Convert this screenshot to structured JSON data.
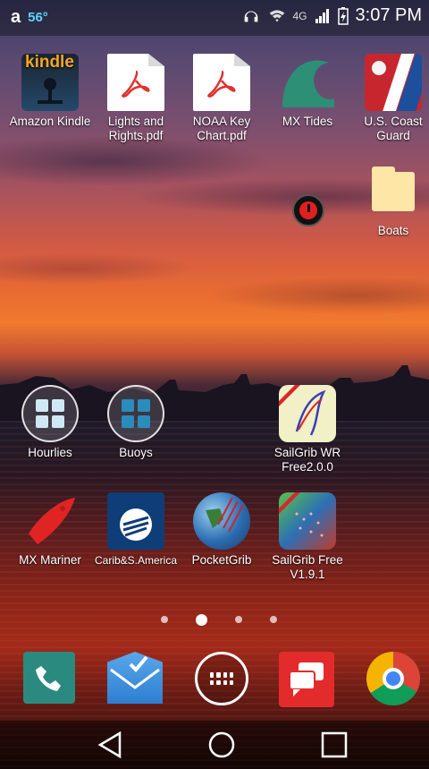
{
  "status_bar": {
    "temperature": "56°",
    "network": "4G",
    "time": "3:07 PM"
  },
  "home_apps": [
    {
      "label": "Amazon Kindle"
    },
    {
      "label": "Lights and Rights.pdf"
    },
    {
      "label": "NOAA Key Chart.pdf"
    },
    {
      "label": "MX Tides"
    },
    {
      "label": "U.S. Coast Guard"
    },
    {
      "label": "Boats"
    },
    {
      "label": "Hourlies"
    },
    {
      "label": "Buoys"
    },
    {
      "label": "SailGrib WR Free2.0.0"
    },
    {
      "label": "MX Mariner"
    },
    {
      "label": "Carib&S.America"
    },
    {
      "label": "PocketGrib"
    },
    {
      "label": "SailGrib Free V1.9.1"
    }
  ],
  "kindle_logo_text": "kindle",
  "page_indicator": {
    "pages": 4,
    "current": 2
  },
  "dock": [
    "phone-icon",
    "inbox-icon",
    "app-drawer-icon",
    "messaging-icon",
    "chrome-icon"
  ],
  "nav": [
    "back-icon",
    "home-icon",
    "recents-icon"
  ],
  "colors": {
    "temperature": "#5fd3ff",
    "power_button": "#e02020"
  }
}
